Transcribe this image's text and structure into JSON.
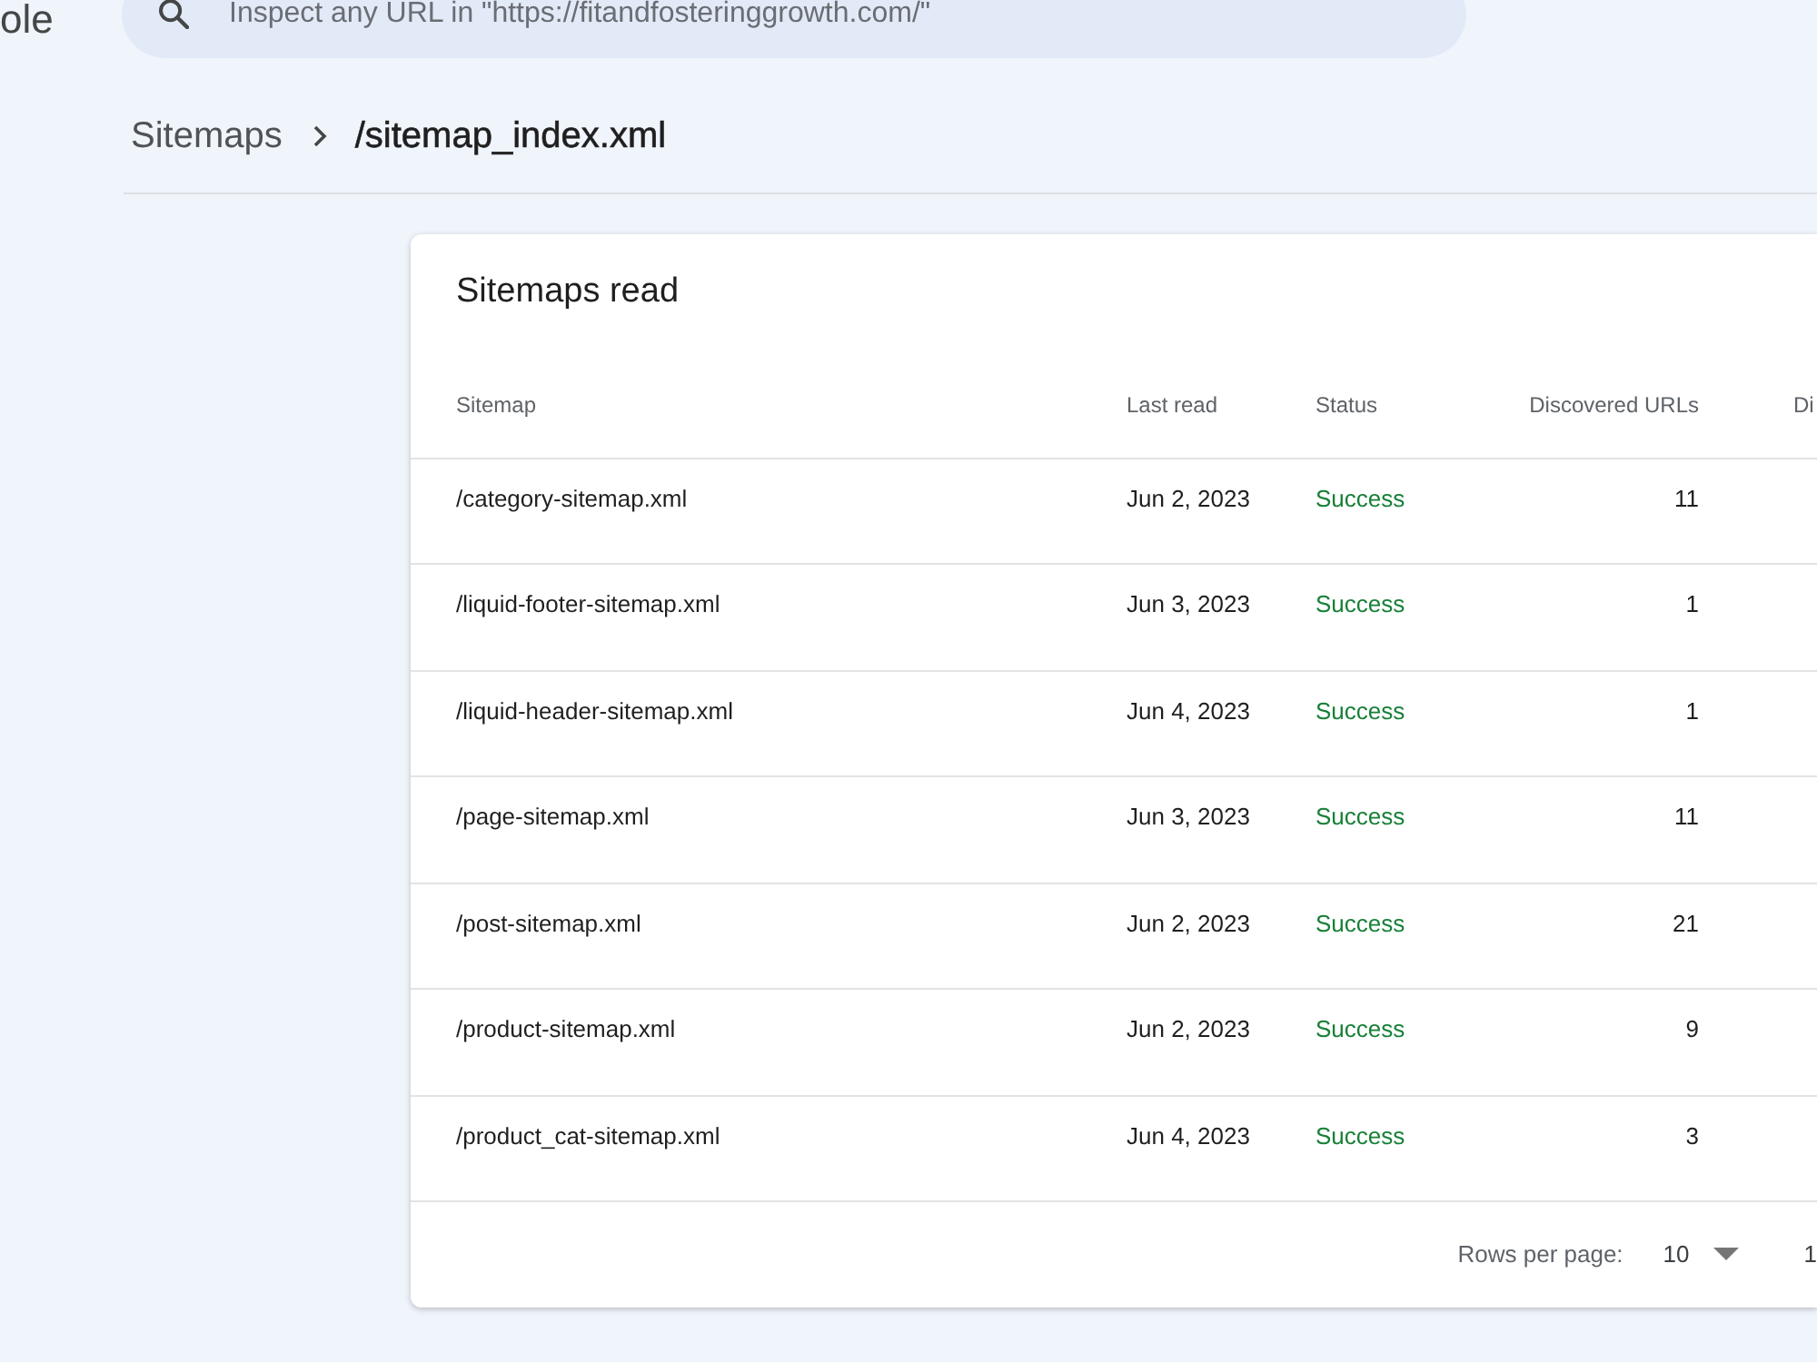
{
  "app_logo": {
    "text": "ole"
  },
  "search": {
    "placeholder": "Inspect any URL in \"https://fitandfosteringgrowth.com/\""
  },
  "breadcrumb": [
    {
      "label": "Sitemaps",
      "current": false
    },
    {
      "label": "/sitemap_index.xml",
      "current": true
    }
  ],
  "card": {
    "title": "Sitemaps read",
    "columns": [
      "Sitemap",
      "Last read",
      "Status",
      "Discovered URLs",
      "Di"
    ],
    "rows": [
      {
        "sitemap": "/category-sitemap.xml",
        "last_read": "Jun 2, 2023",
        "status": {
          "label": "Success",
          "color": "#188038"
        },
        "discovered_urls": "11"
      },
      {
        "sitemap": "/liquid-footer-sitemap.xml",
        "last_read": "Jun 3, 2023",
        "status": {
          "label": "Success",
          "color": "#188038"
        },
        "discovered_urls": "1"
      },
      {
        "sitemap": "/liquid-header-sitemap.xml",
        "last_read": "Jun 4, 2023",
        "status": {
          "label": "Success",
          "color": "#188038"
        },
        "discovered_urls": "1"
      },
      {
        "sitemap": "/page-sitemap.xml",
        "last_read": "Jun 3, 2023",
        "status": {
          "label": "Success",
          "color": "#188038"
        },
        "discovered_urls": "11"
      },
      {
        "sitemap": "/post-sitemap.xml",
        "last_read": "Jun 2, 2023",
        "status": {
          "label": "Success",
          "color": "#188038"
        },
        "discovered_urls": "21"
      },
      {
        "sitemap": "/product-sitemap.xml",
        "last_read": "Jun 2, 2023",
        "status": {
          "label": "Success",
          "color": "#188038"
        },
        "discovered_urls": "9"
      },
      {
        "sitemap": "/product_cat-sitemap.xml",
        "last_read": "Jun 4, 2023",
        "status": {
          "label": "Success",
          "color": "#188038"
        },
        "discovered_urls": "3"
      }
    ],
    "footer": {
      "rows_per_page_label": "Rows per page:",
      "rows_per_page": "10",
      "range": "1"
    }
  }
}
